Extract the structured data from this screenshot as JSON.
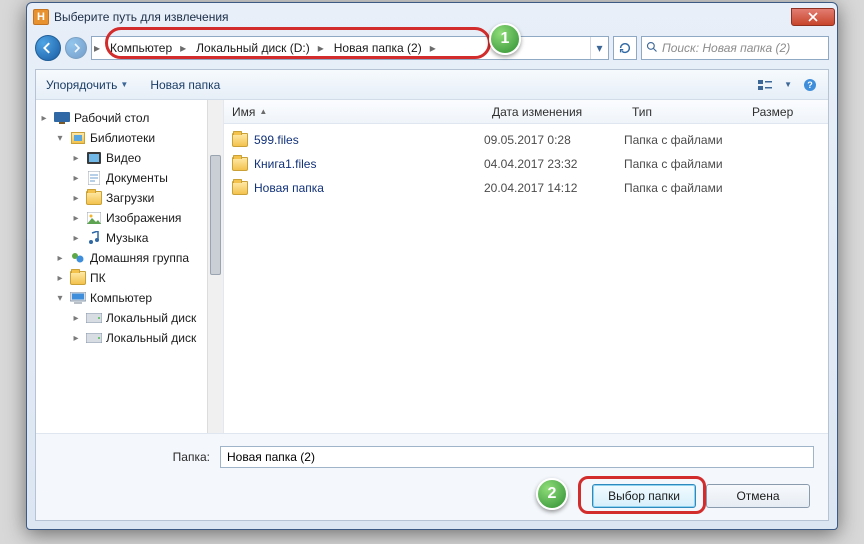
{
  "titlebar": {
    "title": "Выберите путь для извлечения"
  },
  "breadcrumb": {
    "items": [
      "Компьютер",
      "Локальный диск (D:)",
      "Новая папка (2)"
    ]
  },
  "search": {
    "placeholder": "Поиск: Новая папка (2)"
  },
  "toolbar": {
    "organize": "Упорядочить",
    "new_folder": "Новая папка"
  },
  "columns": {
    "name": "Имя",
    "date": "Дата изменения",
    "type": "Тип",
    "size": "Размер"
  },
  "tree": {
    "desktop": "Рабочий стол",
    "libraries": "Библиотеки",
    "video": "Видео",
    "documents": "Документы",
    "downloads": "Загрузки",
    "images": "Изображения",
    "music": "Музыка",
    "homegroup": "Домашняя группа",
    "pc": "ПК",
    "computer": "Компьютер",
    "localdisk_a": "Локальный диск",
    "localdisk_b": "Локальный диск"
  },
  "files": [
    {
      "name": "599.files",
      "date": "09.05.2017 0:28",
      "type": "Папка с файлами",
      "size": ""
    },
    {
      "name": "Книга1.files",
      "date": "04.04.2017 23:32",
      "type": "Папка с файлами",
      "size": ""
    },
    {
      "name": "Новая папка",
      "date": "20.04.2017 14:12",
      "type": "Папка с файлами",
      "size": ""
    }
  ],
  "folder_label": "Папка:",
  "folder_value": "Новая папка (2)",
  "buttons": {
    "select": "Выбор папки",
    "cancel": "Отмена"
  },
  "badges": {
    "addr": "1",
    "select": "2"
  }
}
